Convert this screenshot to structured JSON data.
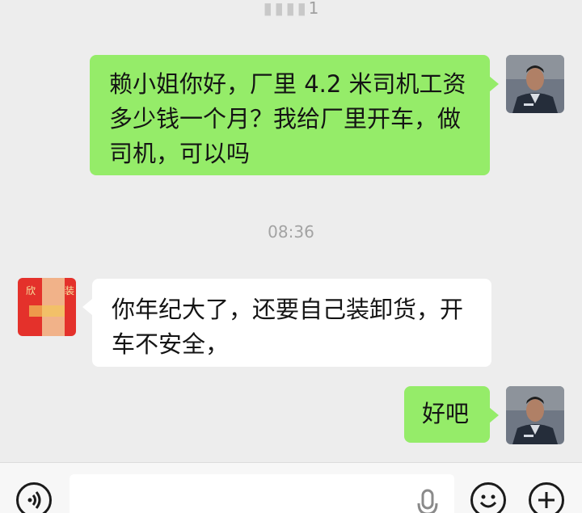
{
  "status_bar": {
    "time": "1"
  },
  "messages": [
    {
      "from": "me",
      "text_lines": [
        "赖小姐你好，厂里 4.2 米司机工资",
        "多少钱一个月？我给厂里开车，做",
        "司机，可以吗"
      ]
    },
    {
      "type": "timestamp",
      "text": "08:36"
    },
    {
      "from": "them",
      "text_lines": [
        "你年纪大了，还要自己装卸货，开",
        "车不安全，"
      ],
      "avatar_text": [
        "欣",
        "装"
      ]
    },
    {
      "from": "me",
      "text_lines": [
        "好吧"
      ]
    }
  ],
  "input_bar": {
    "voice_icon": "voice-icon",
    "mic_icon": "microphone-icon",
    "emoji_icon": "emoji-icon",
    "plus_icon": "plus-icon"
  },
  "colors": {
    "background": "#ededed",
    "my_bubble": "#95ec69",
    "their_bubble": "#ffffff",
    "timestamp": "#a3a3a3"
  }
}
